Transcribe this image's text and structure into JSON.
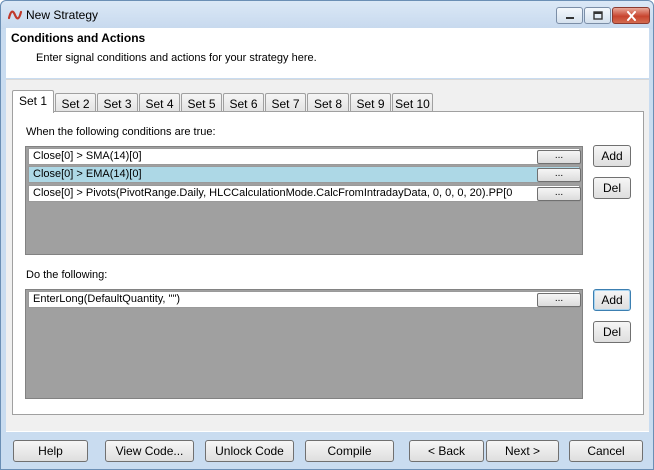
{
  "window": {
    "title": "New Strategy"
  },
  "header": {
    "title": "Conditions and Actions",
    "subtitle": "Enter signal conditions and actions for your strategy here."
  },
  "tabs": [
    {
      "label": "Set 1",
      "active": true
    },
    {
      "label": "Set 2"
    },
    {
      "label": "Set 3"
    },
    {
      "label": "Set 4"
    },
    {
      "label": "Set 5"
    },
    {
      "label": "Set 6"
    },
    {
      "label": "Set 7"
    },
    {
      "label": "Set 8"
    },
    {
      "label": "Set 9"
    },
    {
      "label": "Set 10"
    }
  ],
  "conditions": {
    "label": "When the following conditions are true:",
    "rows": [
      {
        "text": "Close[0] > SMA(14)[0]",
        "selected": false
      },
      {
        "text": "Close[0] > EMA(14)[0]",
        "selected": true
      },
      {
        "text": "Close[0] > Pivots(PivotRange.Daily, HLCCalculationMode.CalcFromIntradayData, 0, 0, 0, 20).PP[0",
        "selected": false
      }
    ],
    "ellipsis_label": "...",
    "add_label": "Add",
    "del_label": "Del"
  },
  "actions": {
    "label": "Do the following:",
    "rows": [
      {
        "text": "EnterLong(DefaultQuantity, \"\")",
        "selected": false
      }
    ],
    "ellipsis_label": "...",
    "add_label": "Add",
    "del_label": "Del"
  },
  "footer": {
    "help": "Help",
    "view_code": "View Code...",
    "unlock_code": "Unlock Code",
    "compile": "Compile",
    "back": "< Back",
    "next": "Next >",
    "cancel": "Cancel"
  },
  "colors": {
    "selected_row": "#add8e6",
    "list_background": "#a0a0a0",
    "title_bar": "#c9dcf0",
    "close_button": "#c8452f"
  },
  "icons": [
    "app-logo-icon",
    "minimize-icon",
    "maximize-icon",
    "close-icon"
  ]
}
